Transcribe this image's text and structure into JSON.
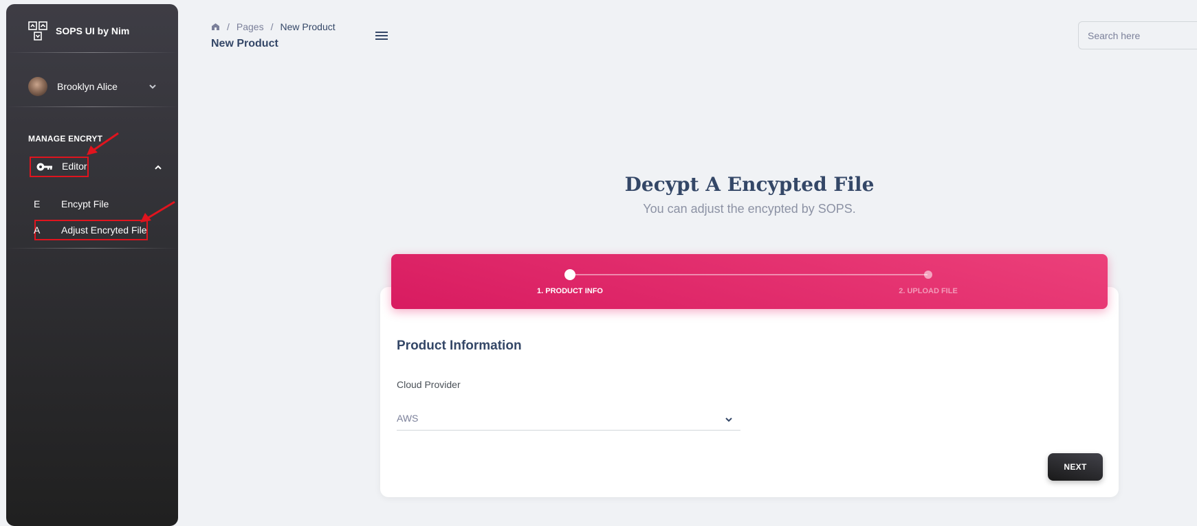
{
  "app": {
    "title": "SOPS UI by Nim",
    "logo_icon": "sops-logo-icon"
  },
  "user": {
    "name": "Brooklyn Alice"
  },
  "sidebar": {
    "section_title": "MANAGE ENCRYT",
    "editor": {
      "label": "Editor",
      "icon": "key-icon",
      "expanded": true
    },
    "items": [
      {
        "letter": "E",
        "label": "Encypt File"
      },
      {
        "letter": "A",
        "label": "Adjust Encryted File"
      }
    ]
  },
  "header": {
    "breadcrumb": {
      "home_icon": "home-icon",
      "items": [
        "Pages",
        "New Product"
      ],
      "separator": "/"
    },
    "title": "New Product",
    "search_placeholder": "Search here"
  },
  "hero": {
    "title": "Decypt A Encypted File",
    "subtitle": "You can adjust the encypted by SOPS."
  },
  "stepper": {
    "steps": [
      {
        "label": "1. PRODUCT INFO",
        "active": true
      },
      {
        "label": "2. UPLOAD FILE",
        "active": false
      }
    ]
  },
  "form": {
    "heading": "Product Information",
    "cloud_provider": {
      "label": "Cloud Provider",
      "value": "AWS"
    },
    "next_label": "NEXT"
  },
  "colors": {
    "accent": "#e91e63",
    "sidebar_dark": "#202020",
    "text_primary": "#344767",
    "annotation": "#e0141e"
  }
}
